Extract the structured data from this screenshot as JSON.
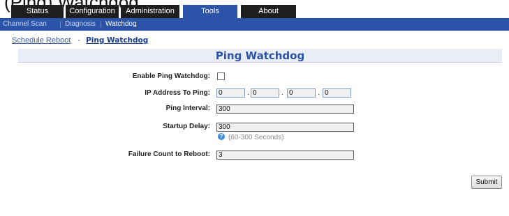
{
  "clipped_heading": "(Ping) Watchdog",
  "top_tabs": [
    {
      "label": "Status"
    },
    {
      "label": "Configuration"
    },
    {
      "label": "Administration"
    },
    {
      "label": "Tools",
      "active": true
    },
    {
      "label": "About"
    }
  ],
  "sub_nav": [
    {
      "label": "Channel Scan"
    },
    {
      "label": "Diagnosis"
    },
    {
      "label": "Watchdog",
      "active": true
    }
  ],
  "breadcrumb": {
    "link": "Schedule Reboot",
    "separator": "-",
    "current": "Ping Watchdog"
  },
  "panel_title": "Ping Watchdog",
  "form": {
    "enable_label": "Enable Ping Watchdog:",
    "enable_checked": false,
    "ip_label": "IP Address To Ping:",
    "ip_octets": [
      "0",
      "0",
      "0",
      "0"
    ],
    "interval_label": "Ping Interval:",
    "interval_value": "300",
    "startup_label": "Startup Delay:",
    "startup_value": "300",
    "startup_hint": "(60-300 Seconds)",
    "failure_label": "Failure Count to Reboot:",
    "failure_value": "3"
  },
  "submit_label": "Submit",
  "colors": {
    "nav_blue": "#2b53a8",
    "tab_dark": "#1e1e1e",
    "title_text": "#2b53a8",
    "title_bar_bg": "#e9edf5"
  },
  "icons": {
    "help": "help-icon"
  }
}
